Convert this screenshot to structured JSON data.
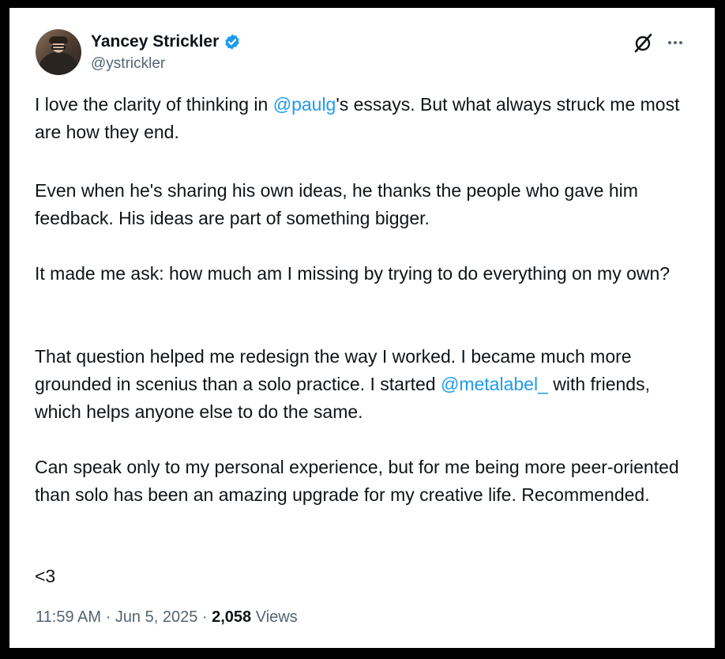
{
  "author": {
    "display_name": "Yancey Strickler",
    "handle": "@ystrickler",
    "verified": true
  },
  "tweet": {
    "p1": {
      "before": "I love the clarity of thinking in ",
      "mention": "@paulg",
      "after": "'s essays. But what always struck me most are how they end."
    },
    "p2": "Even when he's sharing his own ideas, he thanks the people who gave him feedback. His ideas are part of something bigger.",
    "p3": "It made me ask: how much am I missing by trying to do everything on my own?",
    "p4": {
      "before": "That question helped me redesign the way I worked. I became much more grounded in scenius than a solo practice. I started ",
      "mention": "@metalabel_",
      "after": " with friends, which helps anyone else to do the same."
    },
    "p5": "Can speak only to my personal experience, but for me being more peer-oriented than solo has been an amazing upgrade for my creative life. Recommended.",
    "p6": "<3"
  },
  "meta": {
    "time": "11:59 AM",
    "sep1": " · ",
    "date": "Jun 5, 2025",
    "sep2": " · ",
    "views_count": "2,058",
    "views_label": " Views"
  },
  "icons": {
    "verified": "verified-badge-icon",
    "grok": "grok-icon",
    "more": "more-options-icon"
  },
  "colors": {
    "link": "#1d9bf0",
    "verified": "#1d9bf0",
    "text": "#0f1419",
    "secondary": "#536471"
  }
}
